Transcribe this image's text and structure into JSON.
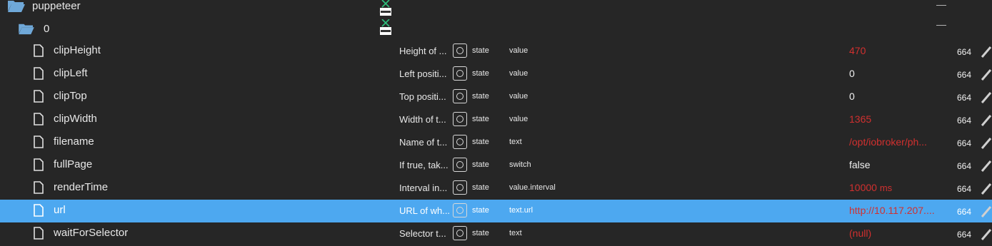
{
  "folders": [
    {
      "name": "puppeteer",
      "dash": "—"
    },
    {
      "name": "0",
      "dash": "—"
    }
  ],
  "logo_label": "Puppeteer",
  "states": [
    {
      "name": "clipHeight",
      "desc": "Height of ...",
      "type": "state",
      "role": "value",
      "value": "470",
      "unit": "",
      "value_color": "red",
      "acl": "664"
    },
    {
      "name": "clipLeft",
      "desc": "Left positi...",
      "type": "state",
      "role": "value",
      "value": "0",
      "unit": "",
      "value_color": "white",
      "acl": "664"
    },
    {
      "name": "clipTop",
      "desc": "Top positi...",
      "type": "state",
      "role": "value",
      "value": "0",
      "unit": "",
      "value_color": "white",
      "acl": "664"
    },
    {
      "name": "clipWidth",
      "desc": "Width of t...",
      "type": "state",
      "role": "value",
      "value": "1365",
      "unit": "",
      "value_color": "red",
      "acl": "664"
    },
    {
      "name": "filename",
      "desc": "Name of t...",
      "type": "state",
      "role": "text",
      "value": "/opt/iobroker/ph...",
      "unit": "",
      "value_color": "red",
      "acl": "664"
    },
    {
      "name": "fullPage",
      "desc": "If true, tak...",
      "type": "state",
      "role": "switch",
      "value": "false",
      "unit": "",
      "value_color": "white",
      "acl": "664"
    },
    {
      "name": "renderTime",
      "desc": "Interval in...",
      "type": "state",
      "role": "value.interval",
      "value": "10000",
      "unit": "ms",
      "value_color": "red",
      "acl": "664"
    },
    {
      "name": "url",
      "desc": "URL of wh...",
      "type": "state",
      "role": "text.url",
      "value": "http://10.117.207....",
      "unit": "",
      "value_color": "red",
      "acl": "664",
      "selected": true
    },
    {
      "name": "waitForSelector",
      "desc": "Selector t...",
      "type": "state",
      "role": "text",
      "value": "(null)",
      "unit": "",
      "value_color": "red",
      "acl": "664"
    }
  ],
  "colors": {
    "background": "#262626",
    "selected_row": "#4da8f0",
    "value_red": "#d1302f",
    "folder_blue": "#6fa8d8"
  },
  "icons": {
    "folder": "folder-open-icon",
    "file": "file-icon",
    "role_button": "circle-icon",
    "edit": "pencil-icon"
  }
}
